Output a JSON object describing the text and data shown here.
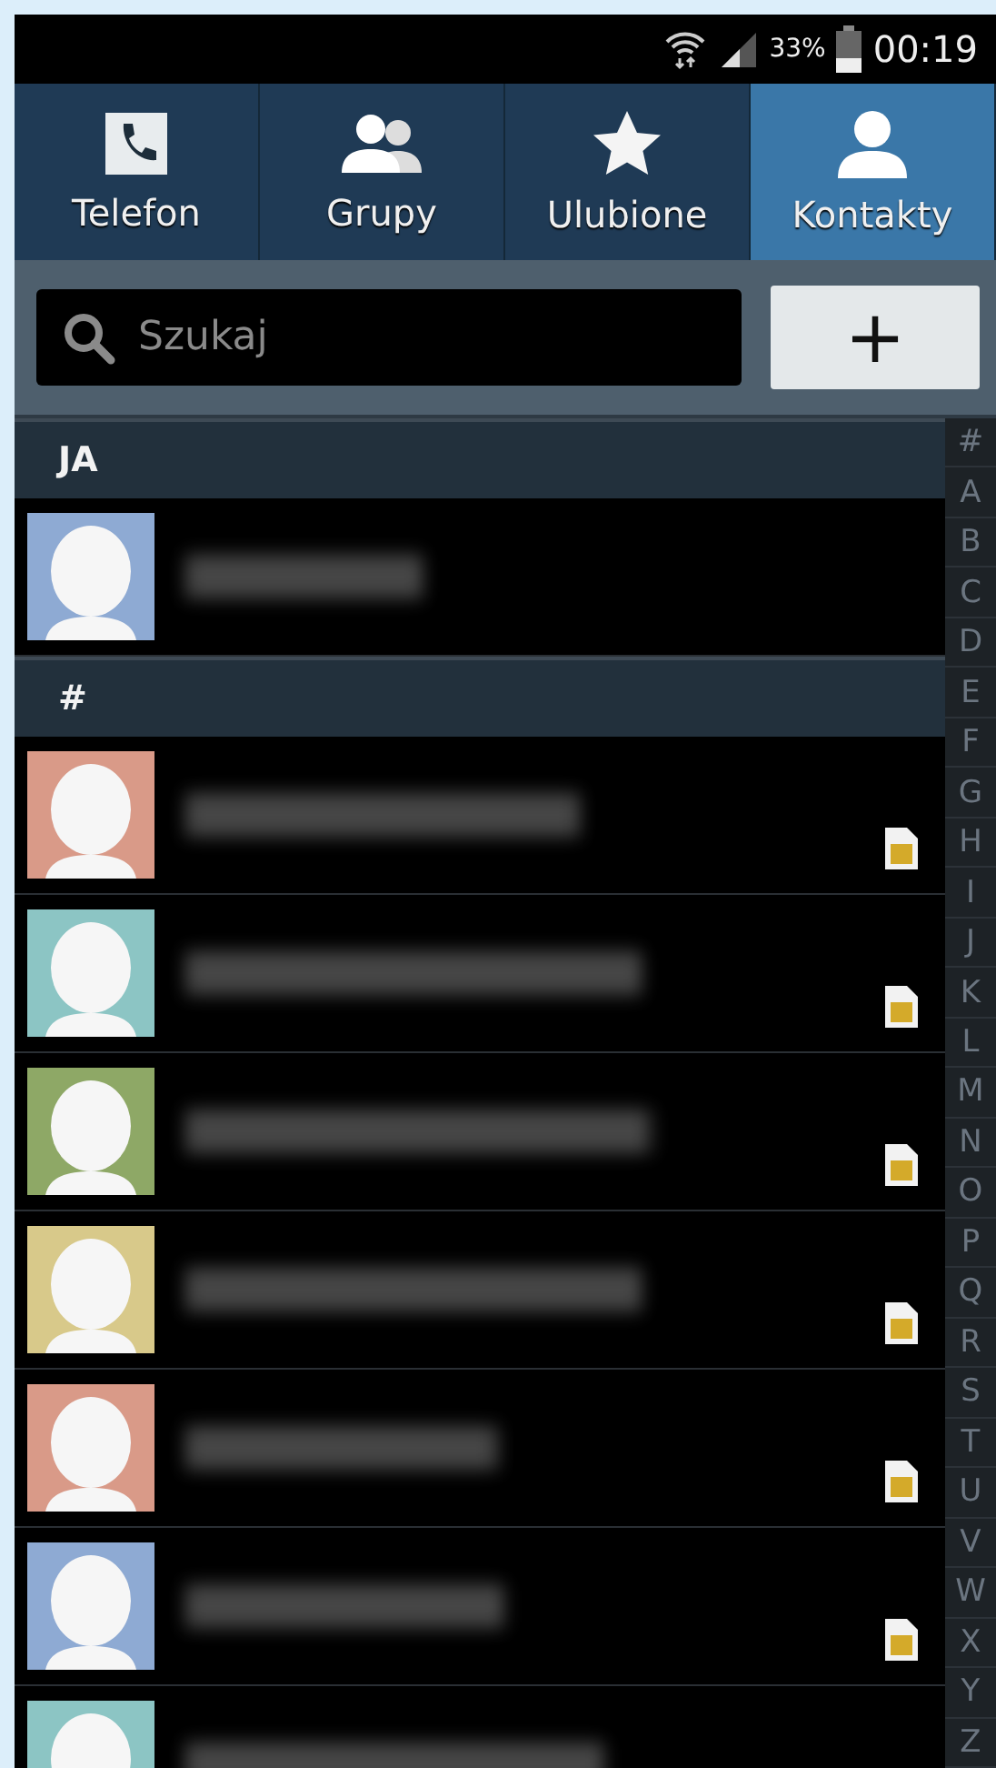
{
  "status_bar": {
    "battery": "33%",
    "time": "00:19"
  },
  "tabs": [
    {
      "label": "Telefon",
      "kind": "phone",
      "selected": false
    },
    {
      "label": "Grupy",
      "kind": "group",
      "selected": false
    },
    {
      "label": "Ulubione",
      "kind": "star",
      "selected": false
    },
    {
      "label": "Kontakty",
      "kind": "person",
      "selected": true
    }
  ],
  "search": {
    "placeholder": "Szukaj"
  },
  "add_button": "+",
  "sections": [
    {
      "title": "JA",
      "contacts": [
        {
          "color": "#8eaad3",
          "sim": false
        }
      ]
    },
    {
      "title": "#",
      "contacts": [
        {
          "color": "#d99a88",
          "sim": true
        },
        {
          "color": "#8cc5c4",
          "sim": true
        },
        {
          "color": "#8ea866",
          "sim": true
        },
        {
          "color": "#d8c98a",
          "sim": true
        },
        {
          "color": "#d99a88",
          "sim": true
        },
        {
          "color": "#8eaad3",
          "sim": true
        },
        {
          "color": "#8cc5c4",
          "sim": false
        }
      ]
    }
  ],
  "index": [
    "#",
    "A",
    "B",
    "C",
    "D",
    "E",
    "F",
    "G",
    "H",
    "I",
    "J",
    "K",
    "L",
    "M",
    "N",
    "O",
    "P",
    "Q",
    "R",
    "S",
    "T",
    "U",
    "V",
    "W",
    "X",
    "Y",
    "Z"
  ]
}
